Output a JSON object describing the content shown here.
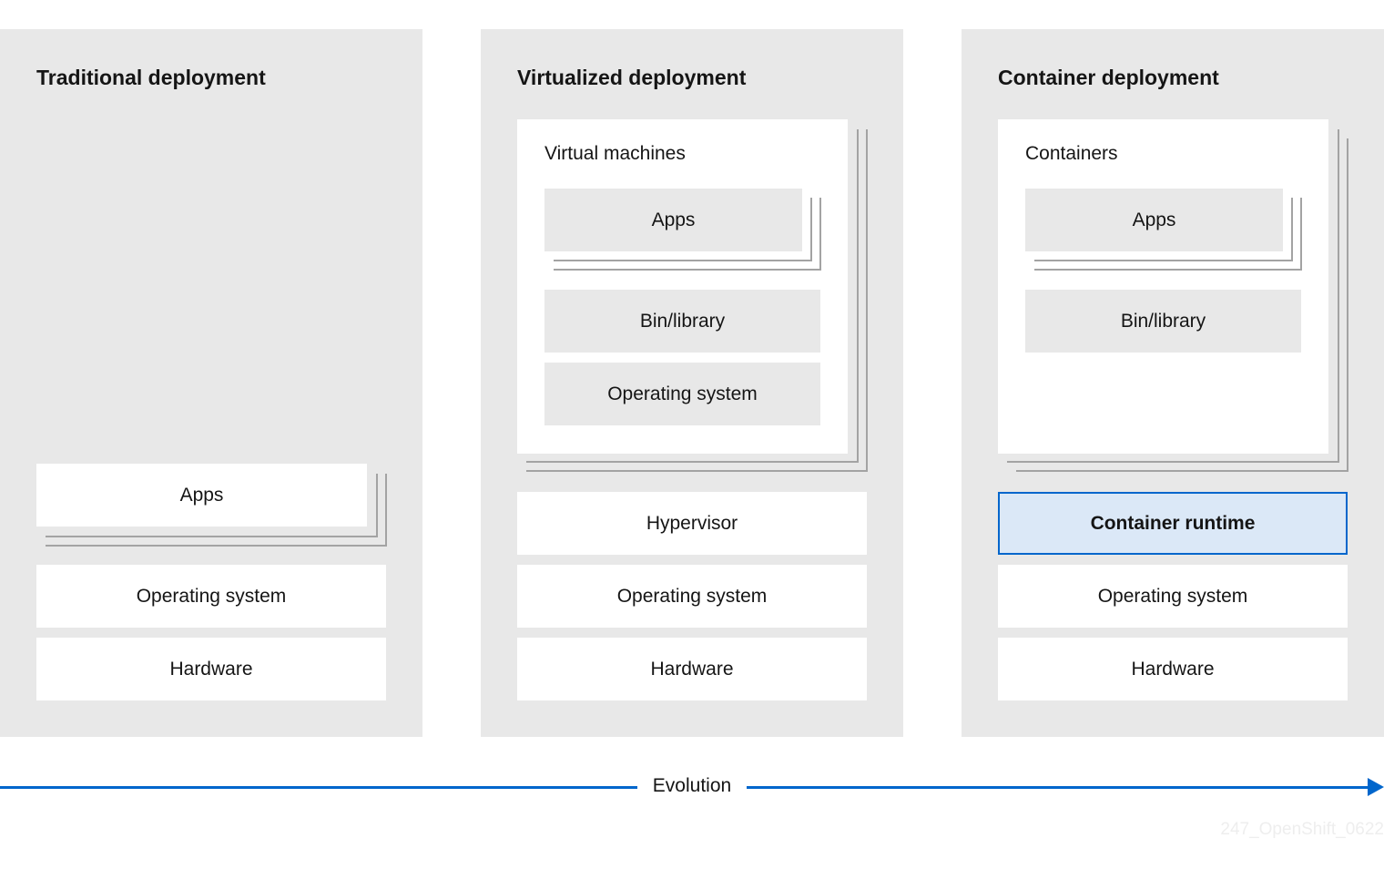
{
  "panels": [
    {
      "title": "Traditional deployment",
      "apps": "Apps",
      "layers": [
        "Operating system",
        "Hardware"
      ]
    },
    {
      "title": "Virtualized deployment",
      "group_label": "Virtual machines",
      "group_items": [
        "Apps",
        "Bin/library",
        "Operating system"
      ],
      "layers": [
        "Hypervisor",
        "Operating system",
        "Hardware"
      ]
    },
    {
      "title": "Container deployment",
      "group_label": "Containers",
      "group_items": [
        "Apps",
        "Bin/library"
      ],
      "layers": [
        "Container runtime",
        "Operating system",
        "Hardware"
      ]
    }
  ],
  "axis": {
    "label": "Evolution"
  },
  "watermark": "247_OpenShift_0622",
  "colors": {
    "accent": "#0066cc",
    "highlight_fill": "#dbe8f7",
    "panel_bg": "#e8e8e8"
  }
}
